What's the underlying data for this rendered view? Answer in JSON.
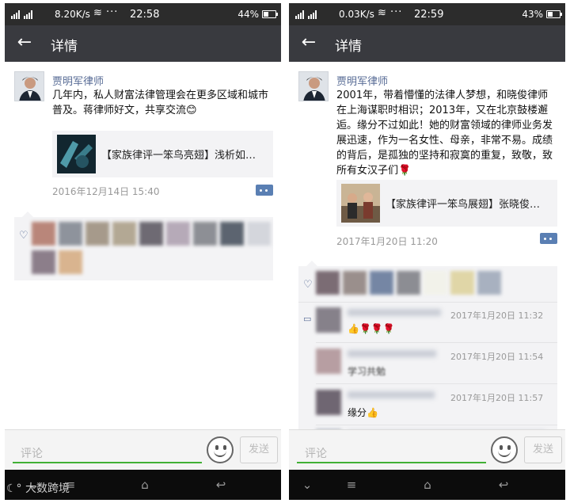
{
  "left": {
    "status": {
      "speed": "8.20K/s",
      "dots": "···",
      "time": "22:58",
      "battery": "44%",
      "battery_level": 0.44
    },
    "header": {
      "title": "详情"
    },
    "post": {
      "author": "贾明军律师",
      "text": "几年内，私人财富法律管理会在更多区域和城市普及。蒋律师好文，共享交流😊",
      "link_title": "【家族律评一笨鸟亮翅】浅析如…",
      "time": "2016年12月14日 15:40"
    },
    "comment_placeholder": "评论",
    "send_label": "发送"
  },
  "right": {
    "status": {
      "speed": "0.03K/s",
      "dots": "···",
      "time": "22:59",
      "battery": "43%",
      "battery_level": 0.43
    },
    "header": {
      "title": "详情"
    },
    "post": {
      "author": "贾明军律师",
      "text": "2001年，带着懵懂的法律人梦想，和晓俊律师在上海谋职时相识；2013年，又在北京鼓楼邂逅。缘分不过如此！她的财富领域的律师业务发展迅速，作为一名女性、母亲，非常不易。成绩的背后，是孤独的坚持和寂寞的重复，致敬，致所有女汉子们🌹",
      "link_title": "【家族律评一笨鸟展翅】张晓俊…",
      "time": "2017年1月20日 11:20"
    },
    "comments": [
      {
        "time": "2017年1月20日 11:32",
        "text": "👍🌹🌹🌹",
        "blurred": false
      },
      {
        "time": "2017年1月20日 11:54",
        "text": "学习共勉",
        "blurred": true
      },
      {
        "time": "2017年1月20日 11:57",
        "text": "缘分👍",
        "blurred": false
      }
    ],
    "comment_placeholder": "评论",
    "send_label": "发送"
  },
  "watermark": "大数跨境",
  "colors": {
    "accent": "#576b95",
    "titlebar": "#393a3f",
    "input_underline": "#41b035"
  }
}
